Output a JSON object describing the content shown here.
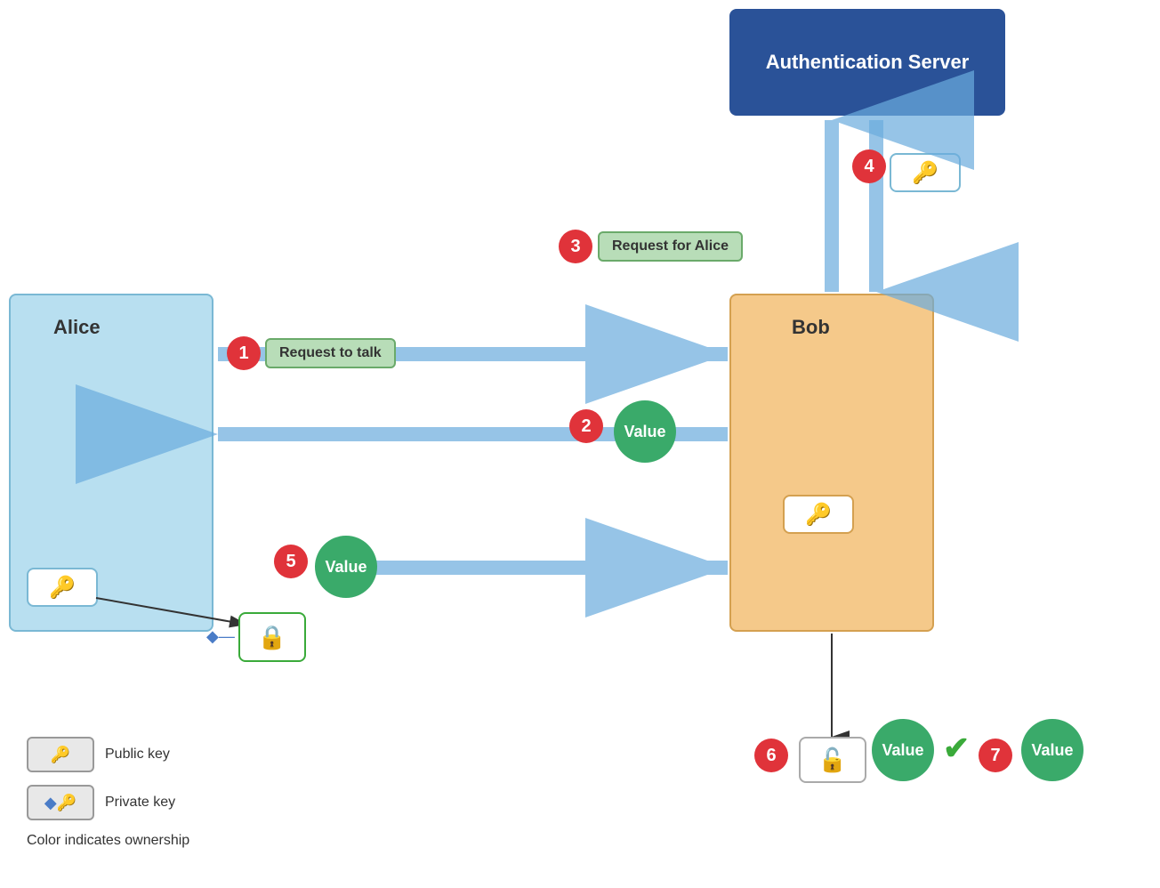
{
  "auth_server": {
    "label": "Authentication Server"
  },
  "alice": {
    "label": "Alice"
  },
  "bob": {
    "label": "Bob"
  },
  "steps": [
    {
      "number": "1",
      "message": "Request to talk"
    },
    {
      "number": "2",
      "message": "Value"
    },
    {
      "number": "3",
      "message": "Request for Alice"
    },
    {
      "number": "4",
      "message": ""
    },
    {
      "number": "5",
      "message": "Value"
    },
    {
      "number": "6",
      "message": ""
    },
    {
      "number": "7",
      "message": "Value"
    }
  ],
  "legend": {
    "public_key_label": "Public key",
    "private_key_label": "Private key",
    "color_note": "Color indicates ownership"
  }
}
